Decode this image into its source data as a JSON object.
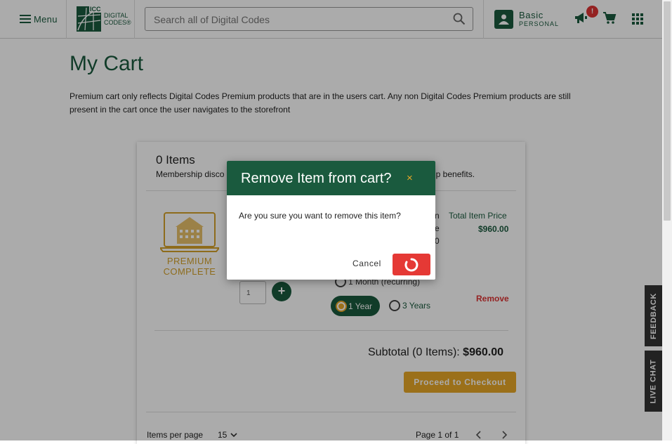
{
  "header": {
    "menu_label": "Menu",
    "logo_top": "ICC",
    "logo_line1": "DIGITAL",
    "logo_line2": "CODES®",
    "search_placeholder": "Search all of Digital Codes",
    "account_name": "Basic",
    "account_plan": "PERSONAL",
    "notification_badge": "!"
  },
  "page": {
    "title": "My Cart",
    "notice": "Premium cart only reflects Digital Codes Premium products that are in the users cart. Any non Digital Codes Premium products are still present in the cart once the user navigates to the storefront"
  },
  "cart": {
    "items_count": "0 Items",
    "membership_note_start": "Membership disco",
    "membership_note_end": "ip benefits.",
    "product_name_line1": "PREMIUM",
    "product_name_line2": "COMPLETE",
    "col_total_label": "Total Item Price",
    "partial_col_1": "n",
    "partial_col_2": "e",
    "partial_col_3": "0",
    "item_price": "$960.00",
    "quantity": "1",
    "plus_label": "+",
    "option_month": "1 Month (recurring)",
    "option_year": "1 Year",
    "option_3years": "3 Years",
    "selected_option": "1 Year",
    "remove_label": "Remove",
    "subtotal_label": "Subtotal (0 Items):",
    "subtotal_value": "$960.00",
    "checkout_label": "Proceed to Checkout",
    "items_per_page_label": "Items per page",
    "items_per_page_value": "15",
    "page_label": "Page 1 of 1"
  },
  "side_tabs": {
    "feedback": "FEEDBACK",
    "live_chat": "LIVE CHAT"
  },
  "dialog": {
    "title": "Remove Item from cart?",
    "close_glyph": "×",
    "message": "Are you sure you want to remove this item?",
    "cancel_label": "Cancel"
  },
  "colors": {
    "brand_green": "#1a5a3e",
    "accent_gold": "#e8a727",
    "danger_red": "#e53935"
  },
  "icons": [
    "hamburger-icon",
    "search-icon",
    "user-icon",
    "megaphone-icon",
    "cart-icon",
    "apps-grid-icon",
    "chevron-down-icon",
    "chevron-left-icon",
    "chevron-right-icon",
    "close-icon",
    "spinner-icon",
    "laptop-building-icon"
  ]
}
